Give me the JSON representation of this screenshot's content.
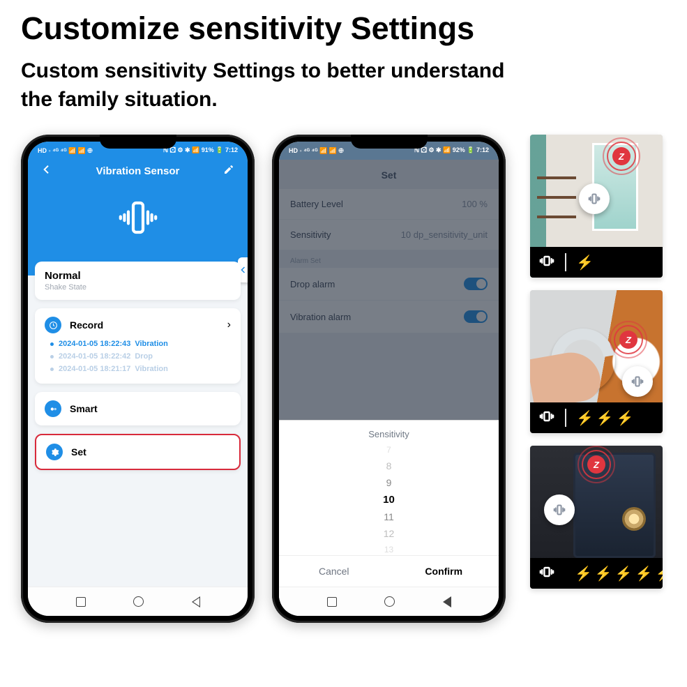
{
  "marketing": {
    "headline": "Customize sensitivity Settings",
    "sub1": "Custom sensitivity Settings to better understand",
    "sub2": "the family situation."
  },
  "phone1": {
    "status_left": "HD ◦ ⁴ᴳ ⁴ᴳ 📶 📶 🕀",
    "status_right": "ℕ 🖸 ⚙ ✱ 📶 91% 🔋 7:12",
    "title": "Vibration Sensor",
    "state_value": "Normal",
    "state_label": "Shake State",
    "record_label": "Record",
    "records": [
      {
        "date": "2024-01-05 18:22:43",
        "event": "Vibration"
      },
      {
        "date": "2024-01-05 18:22:42",
        "event": "Drop"
      },
      {
        "date": "2024-01-05 18:21:17",
        "event": "Vibration"
      }
    ],
    "smart_label": "Smart",
    "set_label": "Set"
  },
  "phone2": {
    "status_left": "HD ◦ ⁴ᴳ ⁴ᴳ 📶 📶 🕀",
    "status_right": "ℕ 🖸 ⚙ ✱ 📶 92% 🔋 7:12",
    "page_title": "Set",
    "rows": {
      "battery_label": "Battery Level",
      "battery_value": "100 %",
      "sens_label": "Sensitivity",
      "sens_value": "10 dp_sensitivity_unit",
      "section": "Alarm Set",
      "drop_label": "Drop alarm",
      "vib_label": "Vibration alarm"
    },
    "sheet": {
      "title": "Sensitivity",
      "options": [
        "7",
        "8",
        "9",
        "10",
        "11",
        "12",
        "13"
      ],
      "selected": "10",
      "cancel": "Cancel",
      "confirm": "Confirm"
    }
  },
  "tiles": {
    "bolts": [
      "1",
      "3",
      "5"
    ]
  }
}
